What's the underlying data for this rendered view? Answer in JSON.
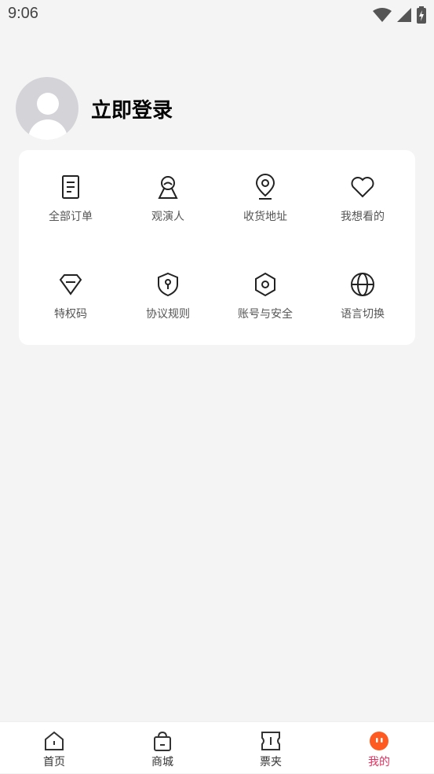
{
  "status_bar": {
    "time": "9:06"
  },
  "profile": {
    "login_label": "立即登录"
  },
  "menu": {
    "items": [
      {
        "label": "全部订单",
        "icon": "document-icon"
      },
      {
        "label": "观演人",
        "icon": "person-icon"
      },
      {
        "label": "收货地址",
        "icon": "location-pin-icon"
      },
      {
        "label": "我想看的",
        "icon": "heart-icon"
      },
      {
        "label": "特权码",
        "icon": "diamond-icon"
      },
      {
        "label": "协议规则",
        "icon": "shield-icon"
      },
      {
        "label": "账号与安全",
        "icon": "hexagon-settings-icon"
      },
      {
        "label": "语言切换",
        "icon": "globe-icon"
      }
    ]
  },
  "tabbar": {
    "tabs": [
      {
        "label": "首页",
        "icon": "home-icon"
      },
      {
        "label": "商城",
        "icon": "shopping-bag-icon"
      },
      {
        "label": "票夹",
        "icon": "ticket-icon"
      },
      {
        "label": "我的",
        "icon": "profile-face-icon",
        "active": true
      }
    ],
    "active_color": "#e5315e",
    "active_icon_color": "#ff5a1f"
  }
}
